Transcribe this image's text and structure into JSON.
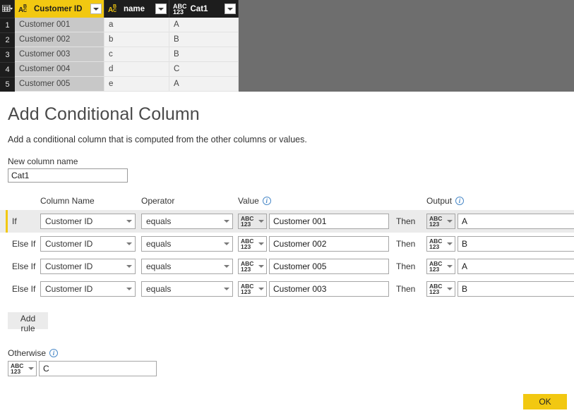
{
  "preview": {
    "corner_icon": "grid-table-icon",
    "columns": [
      {
        "name": "Customer ID",
        "type_icon": "text-type-icon",
        "selected": true,
        "filter_icon": "filter-dropdown-icon"
      },
      {
        "name": "name",
        "type_icon": "text-type-icon",
        "selected": false,
        "filter_icon": "filter-dropdown-icon"
      },
      {
        "name": "Cat1",
        "type_icon": "any-type-icon",
        "selected": false,
        "filter_icon": "filter-dropdown-icon"
      }
    ],
    "rows": [
      {
        "num": "1",
        "cells": [
          "Customer 001",
          "a",
          "A"
        ]
      },
      {
        "num": "2",
        "cells": [
          "Customer 002",
          "b",
          "B"
        ]
      },
      {
        "num": "3",
        "cells": [
          "Customer 003",
          "c",
          "B"
        ]
      },
      {
        "num": "4",
        "cells": [
          "Customer 004",
          "d",
          "C"
        ]
      },
      {
        "num": "5",
        "cells": [
          "Customer 005",
          "e",
          "A"
        ]
      }
    ]
  },
  "dialog": {
    "title": "Add Conditional Column",
    "description": "Add a conditional column that is computed from the other columns or values.",
    "new_column_label": "New column name",
    "new_column_value": "Cat1",
    "headers": {
      "column_name": "Column Name",
      "operator": "Operator",
      "value": "Value",
      "output": "Output",
      "info_icon": "info-icon"
    },
    "rules": [
      {
        "keyword": "If",
        "column": "Customer ID",
        "operator": "equals",
        "value_type": "ABC\n123",
        "value": "Customer 001",
        "then": "Then",
        "output_type": "ABC\n123",
        "output": "A",
        "active": true
      },
      {
        "keyword": "Else If",
        "column": "Customer ID",
        "operator": "equals",
        "value_type": "ABC\n123",
        "value": "Customer 002",
        "then": "Then",
        "output_type": "ABC\n123",
        "output": "B",
        "active": false
      },
      {
        "keyword": "Else If",
        "column": "Customer ID",
        "operator": "equals",
        "value_type": "ABC\n123",
        "value": "Customer 005",
        "then": "Then",
        "output_type": "ABC\n123",
        "output": "A",
        "active": false
      },
      {
        "keyword": "Else If",
        "column": "Customer ID",
        "operator": "equals",
        "value_type": "ABC\n123",
        "value": "Customer 003",
        "then": "Then",
        "output_type": "ABC\n123",
        "output": "B",
        "active": false
      }
    ],
    "add_rule_label": "Add rule",
    "otherwise_label": "Otherwise",
    "otherwise_value": "C",
    "ok_label": "OK"
  },
  "colors": {
    "accent_yellow": "#f2c811",
    "header_dark": "#1d1d1d",
    "backdrop_gray": "#6e6e6e",
    "info_blue": "#4a89c8",
    "row_highlight": "#ebebeb"
  }
}
